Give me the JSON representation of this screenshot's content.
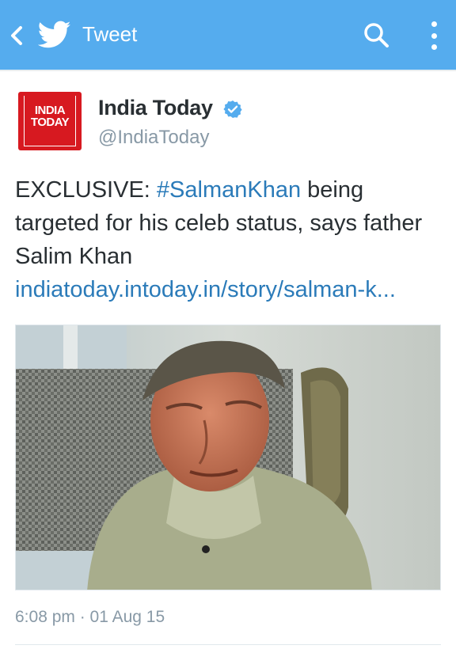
{
  "header": {
    "title": "Tweet",
    "back_icon": "back-chevron-icon",
    "logo_icon": "twitter-bird-icon",
    "search_icon": "search-icon",
    "more_icon": "more-vertical-icon",
    "bar_color": "#55acee"
  },
  "tweet": {
    "author": {
      "name": "India Today",
      "handle": "@IndiaToday",
      "verified": true,
      "avatar_text_line1": "INDIA",
      "avatar_text_line2": "TODAY",
      "avatar_color": "#d71920"
    },
    "text": {
      "prefix": "EXCLUSIVE: ",
      "hashtag": "#SalmanKhan",
      "body": " being targeted for his celeb status, says father Salim Khan",
      "link": "indiatoday.intoday.in/story/salman-k..."
    },
    "media": {
      "description_icon": "photo-image",
      "alt": "Photo"
    },
    "timestamp": "6:08 pm · 01 Aug 15",
    "link_color": "#2b7bb9"
  }
}
